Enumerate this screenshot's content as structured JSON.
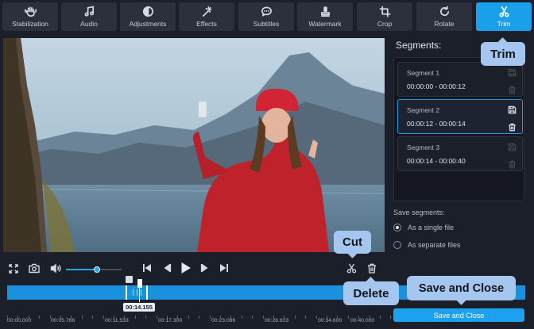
{
  "toolbar": {
    "tools": [
      {
        "label": "Stabilization",
        "icon": "hand-icon"
      },
      {
        "label": "Audio",
        "icon": "music-note-icon"
      },
      {
        "label": "Adjustments",
        "icon": "contrast-icon"
      },
      {
        "label": "Effects",
        "icon": "magic-wand-icon"
      },
      {
        "label": "Subtitles",
        "icon": "speech-bubble-icon"
      },
      {
        "label": "Watermark",
        "icon": "stamp-icon"
      },
      {
        "label": "Crop",
        "icon": "crop-icon"
      },
      {
        "label": "Rotate",
        "icon": "rotate-icon"
      },
      {
        "label": "Trim",
        "icon": "scissors-icon"
      }
    ],
    "active": "Trim"
  },
  "segments": {
    "title": "Segments:",
    "items": [
      {
        "name": "Segment 1",
        "range": "00:00:00 - 00:00:12"
      },
      {
        "name": "Segment 2",
        "range": "00:00:12 - 00:00:14"
      },
      {
        "name": "Segment 3",
        "range": "00:00:14 - 00:00:40"
      }
    ],
    "selected": "Segment 2"
  },
  "save_segments": {
    "label": "Save segments:",
    "options": [
      "As a single file",
      "As separate files"
    ],
    "selected": "As a single file"
  },
  "player": {
    "volume_fraction": 0.55,
    "current_time": "00:14.155"
  },
  "timeline": {
    "ticks": [
      "00:00.000",
      "00:05.766",
      "00:11.533",
      "00:17.300",
      "00:23.066",
      "00:28.833",
      "00:34.600",
      "00:40.000"
    ]
  },
  "save_button": "Save and Close",
  "callouts": {
    "trim": "Trim",
    "cut": "Cut",
    "delete": "Delete",
    "save": "Save and Close"
  },
  "colors": {
    "accent": "#1aa0ea",
    "background": "#1b1f2a",
    "callout": "#a5c6ee"
  }
}
